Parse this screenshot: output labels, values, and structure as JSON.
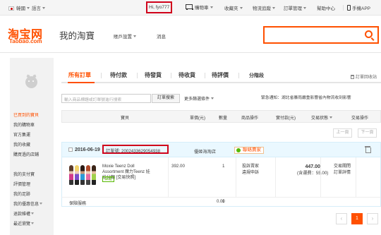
{
  "topbar": {
    "region": "韓國",
    "language": "語言",
    "greeting": "Hi, fyo777",
    "cart": "購物車",
    "favorites": "收藏夾",
    "logistics": "物流追蹤",
    "order_mgmt": "訂單管理",
    "help": "幫助中心",
    "mobile_app": "手機APP"
  },
  "header": {
    "logo_cn": "淘宝网",
    "logo_en": "Taobao.com",
    "title": "我的淘寶",
    "account_settings": "賬戶設置",
    "messages": "消息",
    "search_value": ""
  },
  "sidebar": {
    "items": [
      {
        "label": "已買到的寶貝",
        "active": true
      },
      {
        "label": "我的購物車"
      },
      {
        "label": "官方集運"
      },
      {
        "label": "我的收藏"
      },
      {
        "label": "購買過的店鋪"
      },
      {
        "label": "我的支付寶"
      },
      {
        "label": "評價管理"
      },
      {
        "label": "我的足跡"
      },
      {
        "label": "我的優惠信息"
      },
      {
        "label": "退款維權"
      },
      {
        "label": "最近瀏覽"
      }
    ]
  },
  "tabs": [
    "所有訂單",
    "待付款",
    "待發貨",
    "待收貨",
    "待評價",
    "分階段"
  ],
  "recycle_bin": "訂單回收站",
  "order_search": {
    "placeholder": "輸入商品標題或訂單號進行搜索",
    "button": "訂單搜索",
    "more_filters": "更多篩選條件"
  },
  "notice": "緊急通知：湖北省暴雨嚴重影響省內物流收到影響",
  "table_headers": {
    "item": "寶貝",
    "unit_price": "單價(元)",
    "quantity": "數量",
    "item_ops": "商品操作",
    "paid": "實付款(元)",
    "status": "交易狀態",
    "trade_ops": "交易操作"
  },
  "pager_buttons": {
    "prev": "上一頁",
    "next": "下一頁"
  },
  "order": {
    "date": "2016-06-19",
    "order_no": "訂單號: 2002433629054938",
    "shop": "優姬海淘店",
    "contact": "聯絡賣家",
    "product_title": "Moxie Teenz Doll Assortment 魔力Teenz 娃娃分類 [交易快照]",
    "badge": "保證",
    "price": "392.00",
    "qty": "1",
    "op1": "投訴賣家",
    "op2": "違規申訴",
    "pay_total": "447.00",
    "shipping": "(含運費：55.00)",
    "status1": "交易關閉",
    "status2": "訂單詳情",
    "insurance": "保險服務",
    "ins_price": "0.00",
    "ins_qty": "1"
  },
  "pagination": {
    "current": "1",
    "prev_symbol": "‹",
    "next_symbol": "›"
  }
}
